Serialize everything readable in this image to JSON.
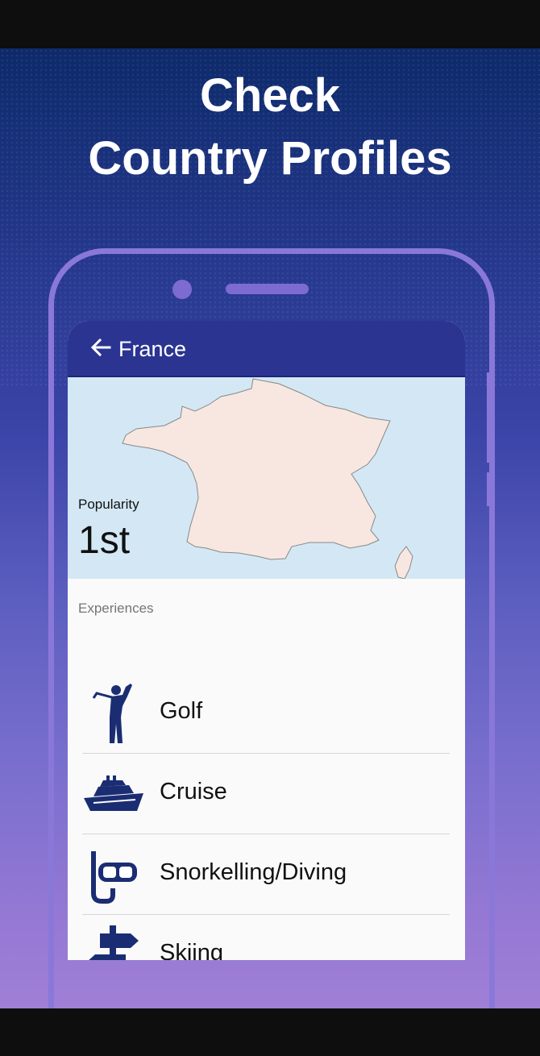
{
  "headline": {
    "line1": "Check",
    "line2": "Country Profiles"
  },
  "appbar": {
    "title": "France",
    "back_icon": "arrow-left-icon"
  },
  "country": {
    "popularity_label": "Popularity",
    "popularity_value": "1st"
  },
  "experiences": {
    "header": "Experiences",
    "items": [
      {
        "label": "Golf",
        "icon": "golfer-icon"
      },
      {
        "label": "Cruise",
        "icon": "cruise-ship-icon"
      },
      {
        "label": "Snorkelling/Diving",
        "icon": "snorkel-mask-icon"
      },
      {
        "label": "Skiing",
        "icon": "signpost-icon"
      }
    ]
  },
  "colors": {
    "appbar": "#2b3491",
    "map_land": "#f7e7e0",
    "map_water": "#d3e8f4",
    "icon": "#1b2d72",
    "phone_frame": "#8a78d8"
  }
}
